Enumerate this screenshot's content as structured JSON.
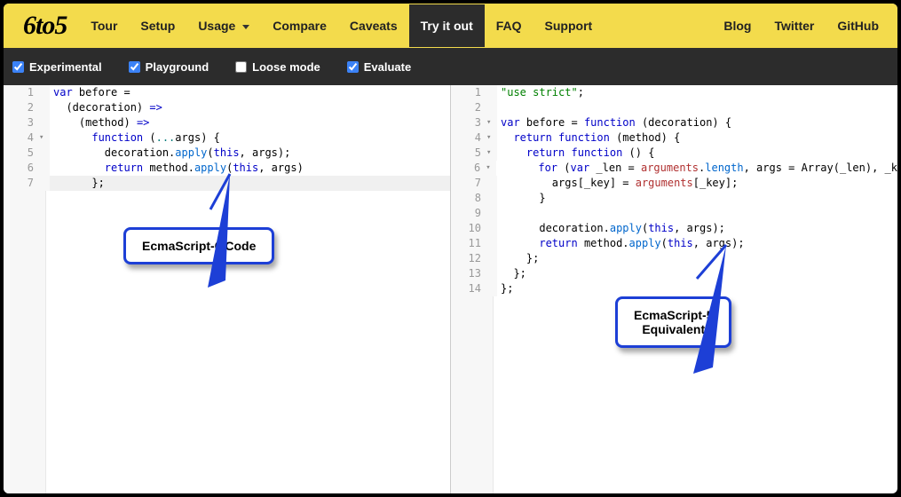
{
  "logo": "6to5",
  "nav": {
    "tour": "Tour",
    "setup": "Setup",
    "usage": "Usage",
    "compare": "Compare",
    "caveats": "Caveats",
    "tryit": "Try it out",
    "faq": "FAQ",
    "support": "Support",
    "blog": "Blog",
    "twitter": "Twitter",
    "github": "GitHub"
  },
  "toolbar": {
    "experimental": "Experimental",
    "playground": "Playground",
    "loosemode": "Loose mode",
    "evaluate": "Evaluate"
  },
  "left_code": [
    {
      "n": "1",
      "fold": "",
      "tokens": [
        [
          "k-blue",
          "var"
        ],
        [
          "",
          " before ="
        ]
      ]
    },
    {
      "n": "2",
      "fold": "",
      "tokens": [
        [
          "indent",
          "  "
        ],
        [
          "",
          "(decoration) "
        ],
        [
          "k-blue",
          "=>"
        ]
      ]
    },
    {
      "n": "3",
      "fold": "",
      "tokens": [
        [
          "indent",
          "    "
        ],
        [
          "",
          "(method) "
        ],
        [
          "k-blue",
          "=>"
        ]
      ]
    },
    {
      "n": "4",
      "fold": "▾",
      "tokens": [
        [
          "indent",
          "      "
        ],
        [
          "k-blue",
          "function"
        ],
        [
          "",
          " ("
        ],
        [
          "k-teal",
          "..."
        ],
        [
          "",
          "args) {"
        ]
      ]
    },
    {
      "n": "5",
      "fold": "",
      "tokens": [
        [
          "indent",
          "        "
        ],
        [
          "",
          "decoration."
        ],
        [
          "k-prop",
          "apply"
        ],
        [
          "",
          "("
        ],
        [
          "k-blue",
          "this"
        ],
        [
          "",
          ", args);"
        ]
      ]
    },
    {
      "n": "6",
      "fold": "",
      "tokens": [
        [
          "indent",
          "        "
        ],
        [
          "k-blue",
          "return"
        ],
        [
          "",
          " method."
        ],
        [
          "k-prop",
          "apply"
        ],
        [
          "",
          "("
        ],
        [
          "k-blue",
          "this"
        ],
        [
          "",
          ", args)"
        ]
      ]
    },
    {
      "n": "7",
      "fold": "",
      "hl": true,
      "tokens": [
        [
          "indent",
          "      "
        ],
        [
          "",
          "};"
        ]
      ]
    }
  ],
  "right_code": [
    {
      "n": "1",
      "fold": "",
      "tokens": [
        [
          "k-str",
          "\"use strict\""
        ],
        [
          "",
          ";"
        ]
      ]
    },
    {
      "n": "2",
      "fold": "",
      "tokens": [
        [
          "",
          ""
        ]
      ]
    },
    {
      "n": "3",
      "fold": "▾",
      "tokens": [
        [
          "k-blue",
          "var"
        ],
        [
          "",
          " before = "
        ],
        [
          "k-blue",
          "function"
        ],
        [
          "",
          " (decoration) {"
        ]
      ]
    },
    {
      "n": "4",
      "fold": "▾",
      "tokens": [
        [
          "indent",
          "  "
        ],
        [
          "k-blue",
          "return"
        ],
        [
          "",
          " "
        ],
        [
          "k-blue",
          "function"
        ],
        [
          "",
          " (method) {"
        ]
      ]
    },
    {
      "n": "5",
      "fold": "▾",
      "tokens": [
        [
          "indent",
          "    "
        ],
        [
          "k-blue",
          "return"
        ],
        [
          "",
          " "
        ],
        [
          "k-blue",
          "function"
        ],
        [
          "",
          " () {"
        ]
      ]
    },
    {
      "n": "6",
      "fold": "▾",
      "tokens": [
        [
          "indent",
          "      "
        ],
        [
          "k-blue",
          "for"
        ],
        [
          "",
          " ("
        ],
        [
          "k-blue",
          "var"
        ],
        [
          "",
          " _len = "
        ],
        [
          "k-red",
          "arguments"
        ],
        [
          "",
          "."
        ],
        [
          "k-prop",
          "length"
        ],
        [
          "",
          ", args = Array(_len), _k"
        ]
      ]
    },
    {
      "n": "7",
      "fold": "",
      "tokens": [
        [
          "indent",
          "        "
        ],
        [
          "",
          "args[_key] = "
        ],
        [
          "k-red",
          "arguments"
        ],
        [
          "",
          "[_key];"
        ]
      ]
    },
    {
      "n": "8",
      "fold": "",
      "tokens": [
        [
          "indent",
          "      "
        ],
        [
          "",
          "}"
        ]
      ]
    },
    {
      "n": "9",
      "fold": "",
      "tokens": [
        [
          "",
          ""
        ]
      ]
    },
    {
      "n": "10",
      "fold": "",
      "tokens": [
        [
          "indent",
          "      "
        ],
        [
          "",
          "decoration."
        ],
        [
          "k-prop",
          "apply"
        ],
        [
          "",
          "("
        ],
        [
          "k-blue",
          "this"
        ],
        [
          "",
          ", args);"
        ]
      ]
    },
    {
      "n": "11",
      "fold": "",
      "tokens": [
        [
          "indent",
          "      "
        ],
        [
          "k-blue",
          "return"
        ],
        [
          "",
          " method."
        ],
        [
          "k-prop",
          "apply"
        ],
        [
          "",
          "("
        ],
        [
          "k-blue",
          "this"
        ],
        [
          "",
          ", args);"
        ]
      ]
    },
    {
      "n": "12",
      "fold": "",
      "tokens": [
        [
          "indent",
          "    "
        ],
        [
          "",
          "};"
        ]
      ]
    },
    {
      "n": "13",
      "fold": "",
      "tokens": [
        [
          "indent",
          "  "
        ],
        [
          "",
          "};"
        ]
      ]
    },
    {
      "n": "14",
      "fold": "",
      "tokens": [
        [
          "",
          "};"
        ]
      ]
    }
  ],
  "callouts": {
    "left": "EcmaScript-6 Code",
    "right_l1": "EcmaScript-5",
    "right_l2": "Equivalent"
  }
}
